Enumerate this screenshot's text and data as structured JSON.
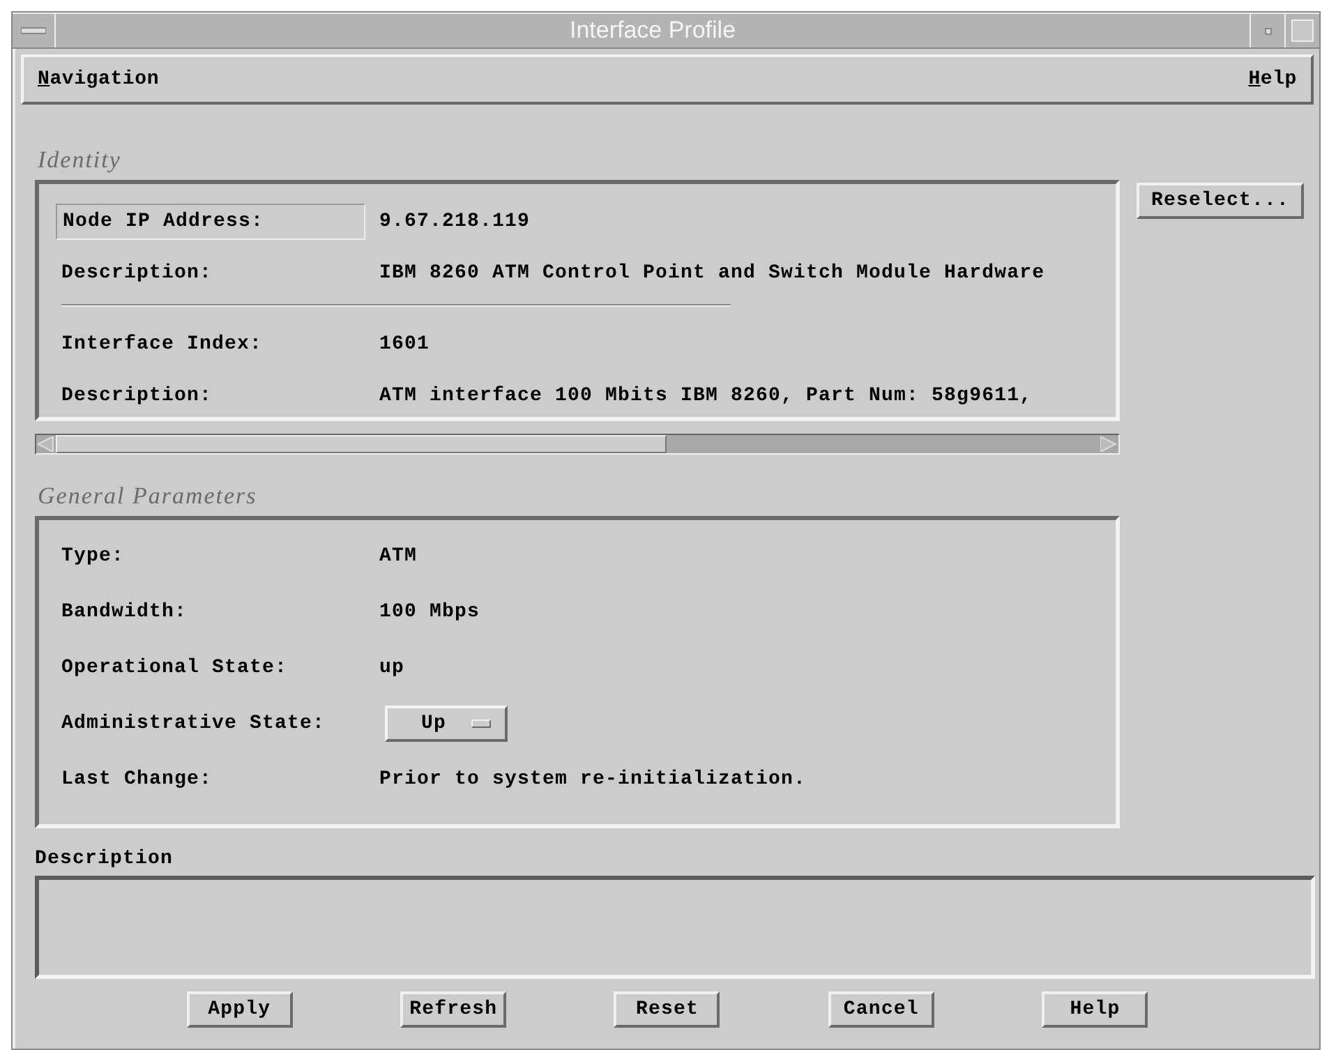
{
  "window": {
    "title": "Interface Profile"
  },
  "menu": [
    {
      "label": "Navigation"
    },
    {
      "label": "Help"
    }
  ],
  "identity": {
    "title": "Identity",
    "groups": [
      [
        {
          "label": "Node IP Address:",
          "value": "9.67.218.119",
          "focused": true
        },
        {
          "label": "Description:",
          "value": "IBM 8260 ATM Control Point and Switch Module Hardware",
          "focused": false
        }
      ],
      [
        {
          "label": "Interface Index:",
          "value": "1601",
          "focused": false
        },
        {
          "label": "Description:",
          "value": "ATM interface 100 Mbits IBM 8260, Part Num: 58g9611,",
          "focused": false
        }
      ]
    ],
    "button": "Reselect..."
  },
  "general": {
    "title": "General Parameters",
    "rows": [
      {
        "kind": "text",
        "label": "Type:",
        "value": "ATM"
      },
      {
        "kind": "text",
        "label": "Bandwidth:",
        "value": "100 Mbps"
      },
      {
        "kind": "text",
        "label": "Operational State:",
        "value": "up"
      },
      {
        "kind": "option",
        "label": "Administrative State:",
        "value": "Up"
      },
      {
        "kind": "text",
        "label": "Last Change:",
        "value": "Prior to system re-initialization."
      }
    ]
  },
  "description": {
    "label": "Description"
  },
  "buttons": [
    "Apply",
    "Refresh",
    "Reset",
    "Cancel",
    "Help"
  ]
}
